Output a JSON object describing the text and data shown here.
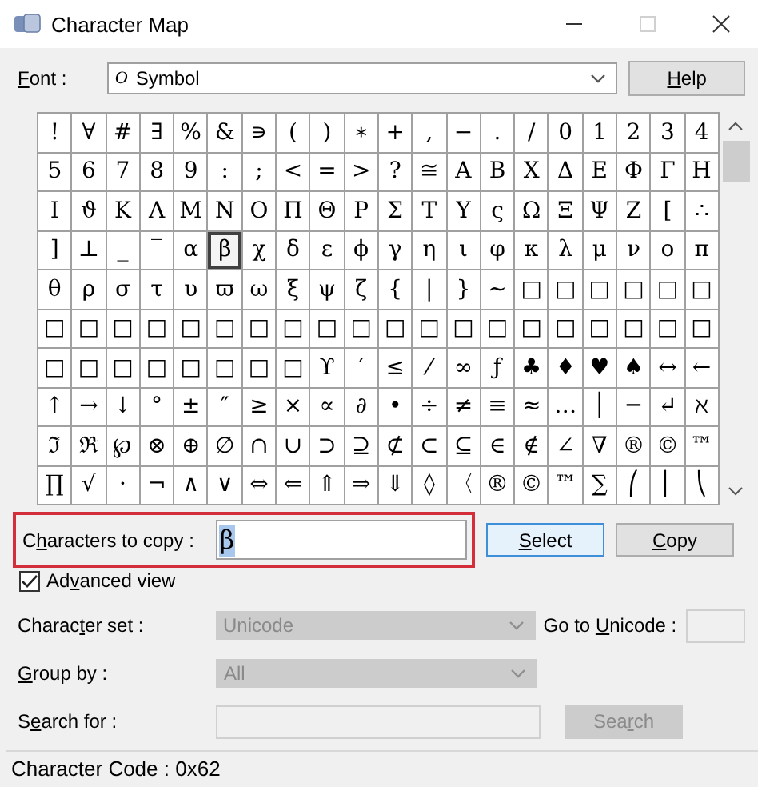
{
  "window": {
    "title": "Character Map",
    "controls": [
      {
        "kind": "minimize",
        "disabled": false
      },
      {
        "kind": "maximize",
        "disabled": true
      },
      {
        "kind": "close",
        "disabled": false
      }
    ]
  },
  "font": {
    "label": {
      "key": "F",
      "post": "ont :"
    },
    "value": "Symbol",
    "font_type_mark": "O",
    "help_button": {
      "key": "H",
      "post": "elp"
    }
  },
  "grid": {
    "rows": [
      [
        {
          "c": "!",
          "selected": false
        },
        {
          "c": "∀",
          "selected": false
        },
        {
          "c": "#",
          "selected": false
        },
        {
          "c": "∃",
          "selected": false
        },
        {
          "c": "%",
          "selected": false
        },
        {
          "c": "&",
          "selected": false
        },
        {
          "c": "∍",
          "selected": false
        },
        {
          "c": "(",
          "selected": false
        },
        {
          "c": ")",
          "selected": false
        },
        {
          "c": "∗",
          "selected": false
        },
        {
          "c": "+",
          "selected": false
        },
        {
          "c": ",",
          "selected": false
        },
        {
          "c": "−",
          "selected": false
        },
        {
          "c": ".",
          "selected": false
        },
        {
          "c": "/",
          "selected": false
        },
        {
          "c": "0",
          "selected": false
        },
        {
          "c": "1",
          "selected": false
        },
        {
          "c": "2",
          "selected": false
        },
        {
          "c": "3",
          "selected": false
        },
        {
          "c": "4",
          "selected": false
        }
      ],
      [
        {
          "c": "5",
          "selected": false
        },
        {
          "c": "6",
          "selected": false
        },
        {
          "c": "7",
          "selected": false
        },
        {
          "c": "8",
          "selected": false
        },
        {
          "c": "9",
          "selected": false
        },
        {
          "c": ":",
          "selected": false
        },
        {
          "c": ";",
          "selected": false
        },
        {
          "c": "<",
          "selected": false
        },
        {
          "c": "=",
          "selected": false
        },
        {
          "c": ">",
          "selected": false
        },
        {
          "c": "?",
          "selected": false
        },
        {
          "c": "≅",
          "selected": false
        },
        {
          "c": "Α",
          "selected": false
        },
        {
          "c": "Β",
          "selected": false
        },
        {
          "c": "Χ",
          "selected": false
        },
        {
          "c": "Δ",
          "selected": false
        },
        {
          "c": "Ε",
          "selected": false
        },
        {
          "c": "Φ",
          "selected": false
        },
        {
          "c": "Γ",
          "selected": false
        },
        {
          "c": "Η",
          "selected": false
        }
      ],
      [
        {
          "c": "Ι",
          "selected": false
        },
        {
          "c": "ϑ",
          "selected": false
        },
        {
          "c": "Κ",
          "selected": false
        },
        {
          "c": "Λ",
          "selected": false
        },
        {
          "c": "Μ",
          "selected": false
        },
        {
          "c": "Ν",
          "selected": false
        },
        {
          "c": "Ο",
          "selected": false
        },
        {
          "c": "Π",
          "selected": false
        },
        {
          "c": "Θ",
          "selected": false
        },
        {
          "c": "Ρ",
          "selected": false
        },
        {
          "c": "Σ",
          "selected": false
        },
        {
          "c": "Τ",
          "selected": false
        },
        {
          "c": "Υ",
          "selected": false
        },
        {
          "c": "ς",
          "selected": false
        },
        {
          "c": "Ω",
          "selected": false
        },
        {
          "c": "Ξ",
          "selected": false
        },
        {
          "c": "Ψ",
          "selected": false
        },
        {
          "c": "Ζ",
          "selected": false
        },
        {
          "c": "[",
          "selected": false
        },
        {
          "c": "∴",
          "selected": false
        }
      ],
      [
        {
          "c": "]",
          "selected": false
        },
        {
          "c": "⊥",
          "selected": false
        },
        {
          "c": "_",
          "selected": false
        },
        {
          "c": "‾",
          "selected": false
        },
        {
          "c": "α",
          "selected": false
        },
        {
          "c": "β",
          "selected": true
        },
        {
          "c": "χ",
          "selected": false
        },
        {
          "c": "δ",
          "selected": false
        },
        {
          "c": "ε",
          "selected": false
        },
        {
          "c": "ϕ",
          "selected": false
        },
        {
          "c": "γ",
          "selected": false
        },
        {
          "c": "η",
          "selected": false
        },
        {
          "c": "ι",
          "selected": false
        },
        {
          "c": "φ",
          "selected": false
        },
        {
          "c": "κ",
          "selected": false
        },
        {
          "c": "λ",
          "selected": false
        },
        {
          "c": "μ",
          "selected": false
        },
        {
          "c": "ν",
          "selected": false
        },
        {
          "c": "ο",
          "selected": false
        },
        {
          "c": "π",
          "selected": false
        }
      ],
      [
        {
          "c": "θ",
          "selected": false
        },
        {
          "c": "ρ",
          "selected": false
        },
        {
          "c": "σ",
          "selected": false
        },
        {
          "c": "τ",
          "selected": false
        },
        {
          "c": "υ",
          "selected": false
        },
        {
          "c": "ϖ",
          "selected": false
        },
        {
          "c": "ω",
          "selected": false
        },
        {
          "c": "ξ",
          "selected": false
        },
        {
          "c": "ψ",
          "selected": false
        },
        {
          "c": "ζ",
          "selected": false
        },
        {
          "c": "{",
          "selected": false
        },
        {
          "c": "|",
          "selected": false
        },
        {
          "c": "}",
          "selected": false
        },
        {
          "c": "~",
          "selected": false
        },
        {
          "c": "□",
          "selected": false
        },
        {
          "c": "□",
          "selected": false
        },
        {
          "c": "□",
          "selected": false
        },
        {
          "c": "□",
          "selected": false
        },
        {
          "c": "□",
          "selected": false
        },
        {
          "c": "□",
          "selected": false
        }
      ],
      [
        {
          "c": "□",
          "selected": false
        },
        {
          "c": "□",
          "selected": false
        },
        {
          "c": "□",
          "selected": false
        },
        {
          "c": "□",
          "selected": false
        },
        {
          "c": "□",
          "selected": false
        },
        {
          "c": "□",
          "selected": false
        },
        {
          "c": "□",
          "selected": false
        },
        {
          "c": "□",
          "selected": false
        },
        {
          "c": "□",
          "selected": false
        },
        {
          "c": "□",
          "selected": false
        },
        {
          "c": "□",
          "selected": false
        },
        {
          "c": "□",
          "selected": false
        },
        {
          "c": "□",
          "selected": false
        },
        {
          "c": "□",
          "selected": false
        },
        {
          "c": "□",
          "selected": false
        },
        {
          "c": "□",
          "selected": false
        },
        {
          "c": "□",
          "selected": false
        },
        {
          "c": "□",
          "selected": false
        },
        {
          "c": "□",
          "selected": false
        },
        {
          "c": "□",
          "selected": false
        }
      ],
      [
        {
          "c": "□",
          "selected": false
        },
        {
          "c": "□",
          "selected": false
        },
        {
          "c": "□",
          "selected": false
        },
        {
          "c": "□",
          "selected": false
        },
        {
          "c": "□",
          "selected": false
        },
        {
          "c": "□",
          "selected": false
        },
        {
          "c": "□",
          "selected": false
        },
        {
          "c": "□",
          "selected": false
        },
        {
          "c": "ϒ",
          "selected": false
        },
        {
          "c": "′",
          "selected": false
        },
        {
          "c": "≤",
          "selected": false
        },
        {
          "c": "⁄",
          "selected": false
        },
        {
          "c": "∞",
          "selected": false
        },
        {
          "c": "ƒ",
          "selected": false
        },
        {
          "c": "♣",
          "selected": false
        },
        {
          "c": "♦",
          "selected": false
        },
        {
          "c": "♥",
          "selected": false
        },
        {
          "c": "♠",
          "selected": false
        },
        {
          "c": "↔",
          "selected": false
        },
        {
          "c": "←",
          "selected": false
        }
      ],
      [
        {
          "c": "↑",
          "selected": false
        },
        {
          "c": "→",
          "selected": false
        },
        {
          "c": "↓",
          "selected": false
        },
        {
          "c": "°",
          "selected": false
        },
        {
          "c": "±",
          "selected": false
        },
        {
          "c": "″",
          "selected": false
        },
        {
          "c": "≥",
          "selected": false
        },
        {
          "c": "×",
          "selected": false
        },
        {
          "c": "∝",
          "selected": false
        },
        {
          "c": "∂",
          "selected": false
        },
        {
          "c": "•",
          "selected": false
        },
        {
          "c": "÷",
          "selected": false
        },
        {
          "c": "≠",
          "selected": false
        },
        {
          "c": "≡",
          "selected": false
        },
        {
          "c": "≈",
          "selected": false
        },
        {
          "c": "…",
          "selected": false
        },
        {
          "c": "│",
          "selected": false
        },
        {
          "c": "─",
          "selected": false
        },
        {
          "c": "↵",
          "selected": false
        },
        {
          "c": "ℵ",
          "selected": false
        }
      ],
      [
        {
          "c": "ℑ",
          "selected": false
        },
        {
          "c": "ℜ",
          "selected": false
        },
        {
          "c": "℘",
          "selected": false
        },
        {
          "c": "⊗",
          "selected": false
        },
        {
          "c": "⊕",
          "selected": false
        },
        {
          "c": "∅",
          "selected": false
        },
        {
          "c": "∩",
          "selected": false
        },
        {
          "c": "∪",
          "selected": false
        },
        {
          "c": "⊃",
          "selected": false
        },
        {
          "c": "⊇",
          "selected": false
        },
        {
          "c": "⊄",
          "selected": false
        },
        {
          "c": "⊂",
          "selected": false
        },
        {
          "c": "⊆",
          "selected": false
        },
        {
          "c": "∈",
          "selected": false
        },
        {
          "c": "∉",
          "selected": false
        },
        {
          "c": "∠",
          "selected": false
        },
        {
          "c": "∇",
          "selected": false
        },
        {
          "c": "®",
          "selected": false
        },
        {
          "c": "©",
          "selected": false
        },
        {
          "c": "™",
          "selected": false
        }
      ],
      [
        {
          "c": "∏",
          "selected": false
        },
        {
          "c": "√",
          "selected": false
        },
        {
          "c": "·",
          "selected": false
        },
        {
          "c": "¬",
          "selected": false
        },
        {
          "c": "∧",
          "selected": false
        },
        {
          "c": "∨",
          "selected": false
        },
        {
          "c": "⇔",
          "selected": false
        },
        {
          "c": "⇐",
          "selected": false
        },
        {
          "c": "⇑",
          "selected": false
        },
        {
          "c": "⇒",
          "selected": false
        },
        {
          "c": "⇓",
          "selected": false
        },
        {
          "c": "◊",
          "selected": false
        },
        {
          "c": "〈",
          "selected": false
        },
        {
          "c": "®",
          "selected": false
        },
        {
          "c": "©",
          "selected": false
        },
        {
          "c": "™",
          "selected": false
        },
        {
          "c": "∑",
          "selected": false
        },
        {
          "c": "⎛",
          "selected": false
        },
        {
          "c": "⎜",
          "selected": false
        },
        {
          "c": "⎝",
          "selected": false
        }
      ]
    ]
  },
  "copy": {
    "label": {
      "pre": "C",
      "key": "h",
      "post": "aracters to copy :"
    },
    "value": "β",
    "highlighted": true,
    "buttons": [
      {
        "label": {
          "key": "S",
          "post": "elect"
        },
        "focused": true
      },
      {
        "label": {
          "key": "C",
          "post": "opy"
        },
        "focused": false
      }
    ]
  },
  "advanced_view": {
    "label": {
      "pre": "Ad",
      "key": "v",
      "post": "anced view"
    },
    "checked": true
  },
  "character_set": {
    "label": {
      "pre": "Charac",
      "key": "t",
      "post": "er set :"
    },
    "value": "Unicode",
    "disabled": true,
    "goto_label": {
      "pre": "Go to ",
      "key": "U",
      "post": "nicode :"
    }
  },
  "group_by": {
    "label": {
      "key": "G",
      "post": "roup by :"
    },
    "value": "All",
    "disabled": true
  },
  "search": {
    "label": {
      "pre": "S",
      "key": "e",
      "post": "arch for :"
    },
    "button": {
      "pre": "Sea",
      "key": "r",
      "post": "ch"
    },
    "disabled": true
  },
  "status_bar": "Character Code : 0x62"
}
